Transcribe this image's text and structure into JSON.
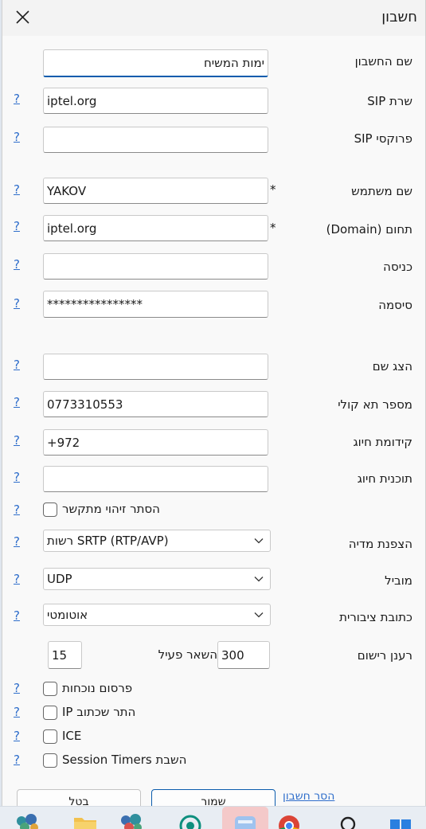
{
  "window": {
    "title": "חשבון"
  },
  "fields": {
    "account_name": {
      "label": "שם החשבון",
      "value": "ימות המשיח"
    },
    "sip_server": {
      "label": "שרת SIP",
      "value": "iptel.org"
    },
    "sip_proxy": {
      "label": "פרוקסי SIP",
      "value": ""
    },
    "username": {
      "label": "שם משתמש",
      "value": "YAKOV"
    },
    "domain": {
      "label": "תחום (Domain)",
      "value": "iptel.org"
    },
    "login": {
      "label": "כניסה",
      "value": ""
    },
    "password": {
      "label": "סיסמה",
      "value": "****************"
    },
    "display_name": {
      "label": "הצג שם",
      "value": ""
    },
    "voicemail": {
      "label": "מספר תא קולי",
      "value": "0773310553"
    },
    "dial_prefix": {
      "label": "קידומת חיוג",
      "value": "+972"
    },
    "dial_plan": {
      "label": "תוכנית חיוג",
      "value": ""
    },
    "hide_caller_id": {
      "label": "הסתר זיהוי מתקשר",
      "checked": false
    },
    "media_encryption": {
      "label": "הצפנת מדיה",
      "value": "SRTP (RTP/AVP) רשות"
    },
    "transport": {
      "label": "מוביל",
      "value": "UDP"
    },
    "public_address": {
      "label": "כתובת ציבורית",
      "value": "אוטומטי"
    },
    "register_refresh": {
      "label": "רענן רישום",
      "value": "300"
    },
    "keep_alive": {
      "label": "השאר פעיל",
      "value": "15"
    },
    "publish_presence": {
      "label": "פרסום נוכחות",
      "checked": false
    },
    "allow_ip_rewrite": {
      "label": "IP התר שכתוב",
      "checked": false
    },
    "ice": {
      "label": "ICE",
      "checked": false
    },
    "disable_session_timers": {
      "label": "השבת Session Timers",
      "checked": false
    }
  },
  "required_marker": "*",
  "help_marker": "?",
  "footer": {
    "cancel_label": "בטל",
    "save_label": "שמור",
    "remove_link": "הסר חשבון"
  },
  "colors": {
    "accent": "#0b5cad",
    "link": "#2f6ecb"
  },
  "taskbar": {
    "icons": [
      "app-cluster-icon",
      "folder-icon",
      "app-cluster-icon",
      "whatsapp-icon",
      "active-app-icon",
      "chrome-icon",
      "search-icon",
      "start-icon"
    ]
  }
}
